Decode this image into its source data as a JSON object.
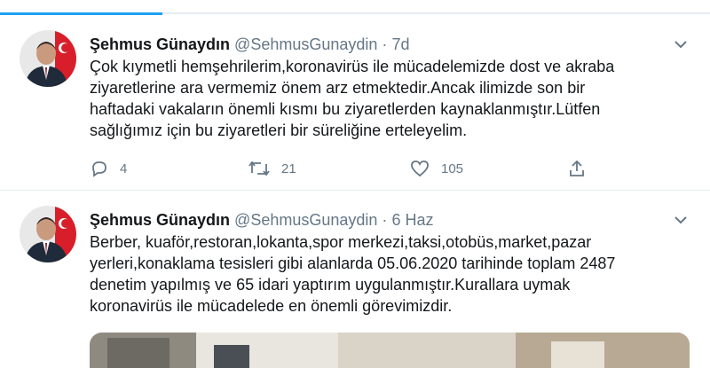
{
  "tweets": [
    {
      "name": "Şehmus Günaydın",
      "handle": "@SehmusGunaydin",
      "separator": "·",
      "time": "7d",
      "text": "Çok kıymetli hemşehrilerim,koronavirüs ile mücadelemizde dost ve akraba\nziyaretlerine ara vermemiz önem arz etmektedir.Ancak  ilimizde son bir\nhaftadaki vakaların önemli kısmı bu ziyaretlerden kaynaklanmıştır.Lütfen\nsağlığımız için bu ziyaretleri bir süreliğine erteleyelim.",
      "reply_count": "4",
      "retweet_count": "21",
      "like_count": "105"
    },
    {
      "name": "Şehmus Günaydın",
      "handle": "@SehmusGunaydin",
      "separator": "·",
      "time": "6 Haz",
      "text": "Berber, kuaför,restoran,lokanta,spor merkezi,taksi,otobüs,market,pazar\nyerleri,konaklama tesisleri gibi alanlarda 05.06.2020 tarihinde toplam 2487\ndenetim yapılmış ve 65 idari yaptırım uygulanmıştır.Kurallara uymak\nkoronavirüs ile mücadelede en önemli görevimizdir."
    }
  ],
  "icons": {
    "reply": "reply-icon",
    "retweet": "retweet-icon",
    "like": "heart-icon",
    "share": "share-icon",
    "more": "chevron-down-icon"
  },
  "colors": {
    "accent": "#1da1f2",
    "muted": "#657786",
    "text": "#14171a",
    "divider": "#e6ecf0"
  }
}
